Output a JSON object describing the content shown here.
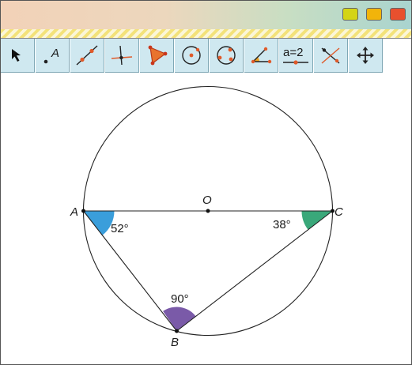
{
  "window": {
    "buttons": [
      {
        "name": "minimize",
        "color": "#d4d416"
      },
      {
        "name": "maximize",
        "color": "#f2b40a"
      },
      {
        "name": "close",
        "color": "#e8502e"
      }
    ]
  },
  "toolbar": {
    "tools": [
      {
        "id": "move",
        "icon": "arrow-pointer-icon"
      },
      {
        "id": "point",
        "icon": "point-icon",
        "label": "A"
      },
      {
        "id": "line",
        "icon": "line-icon"
      },
      {
        "id": "perpendicular",
        "icon": "perpendicular-line-icon"
      },
      {
        "id": "polygon",
        "icon": "polygon-icon"
      },
      {
        "id": "circle-center",
        "icon": "circle-center-icon"
      },
      {
        "id": "circle-three-points",
        "icon": "circle-three-points-icon"
      },
      {
        "id": "angle",
        "icon": "angle-icon"
      },
      {
        "id": "slider",
        "icon": "slider-icon",
        "label": "a=2"
      },
      {
        "id": "intersect",
        "icon": "intersect-icon"
      },
      {
        "id": "move-view",
        "icon": "move-graphics-view-icon"
      }
    ]
  },
  "figure": {
    "points": {
      "A": "A",
      "B": "B",
      "C": "C",
      "O": "O"
    },
    "angles": {
      "A": {
        "label": "52°",
        "color": "#3a9edb"
      },
      "B": {
        "label": "90°",
        "color": "#7a5aa8"
      },
      "C": {
        "label": "38°",
        "color": "#3aa87a"
      }
    }
  }
}
